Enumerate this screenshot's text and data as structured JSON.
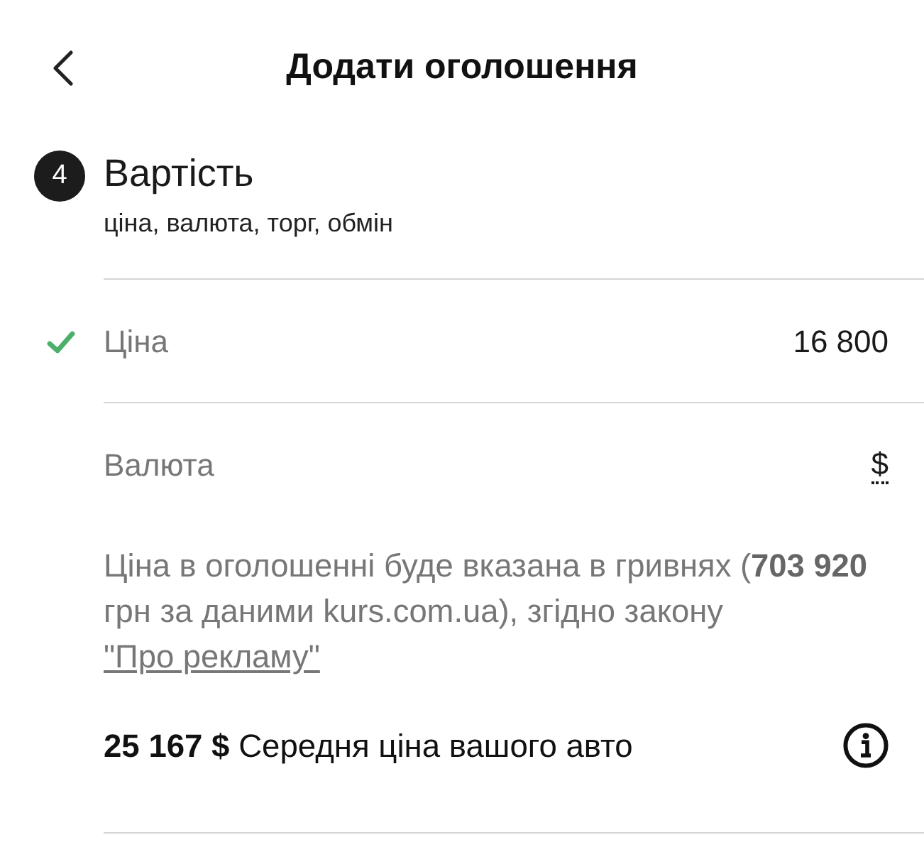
{
  "header": {
    "title": "Додати оголошення"
  },
  "section": {
    "step": "4",
    "title": "Вартість",
    "subtitle": "ціна, валюта, торг, обмін"
  },
  "fields": [
    {
      "kind": "input",
      "label": "Ціна",
      "value": "16 800",
      "valid": true
    },
    {
      "kind": "select",
      "label": "Валюта",
      "value": "$",
      "valid": false
    }
  ],
  "note": {
    "text": "Ціна в оголошенні буде вказана в гривнях (**703 920** грн за даними kurs.com.ua), згідно закону",
    "link": "\"Про рекламу\""
  },
  "average_price": {
    "text": "**25 167 $** Середня ціна вашого авто"
  }
}
